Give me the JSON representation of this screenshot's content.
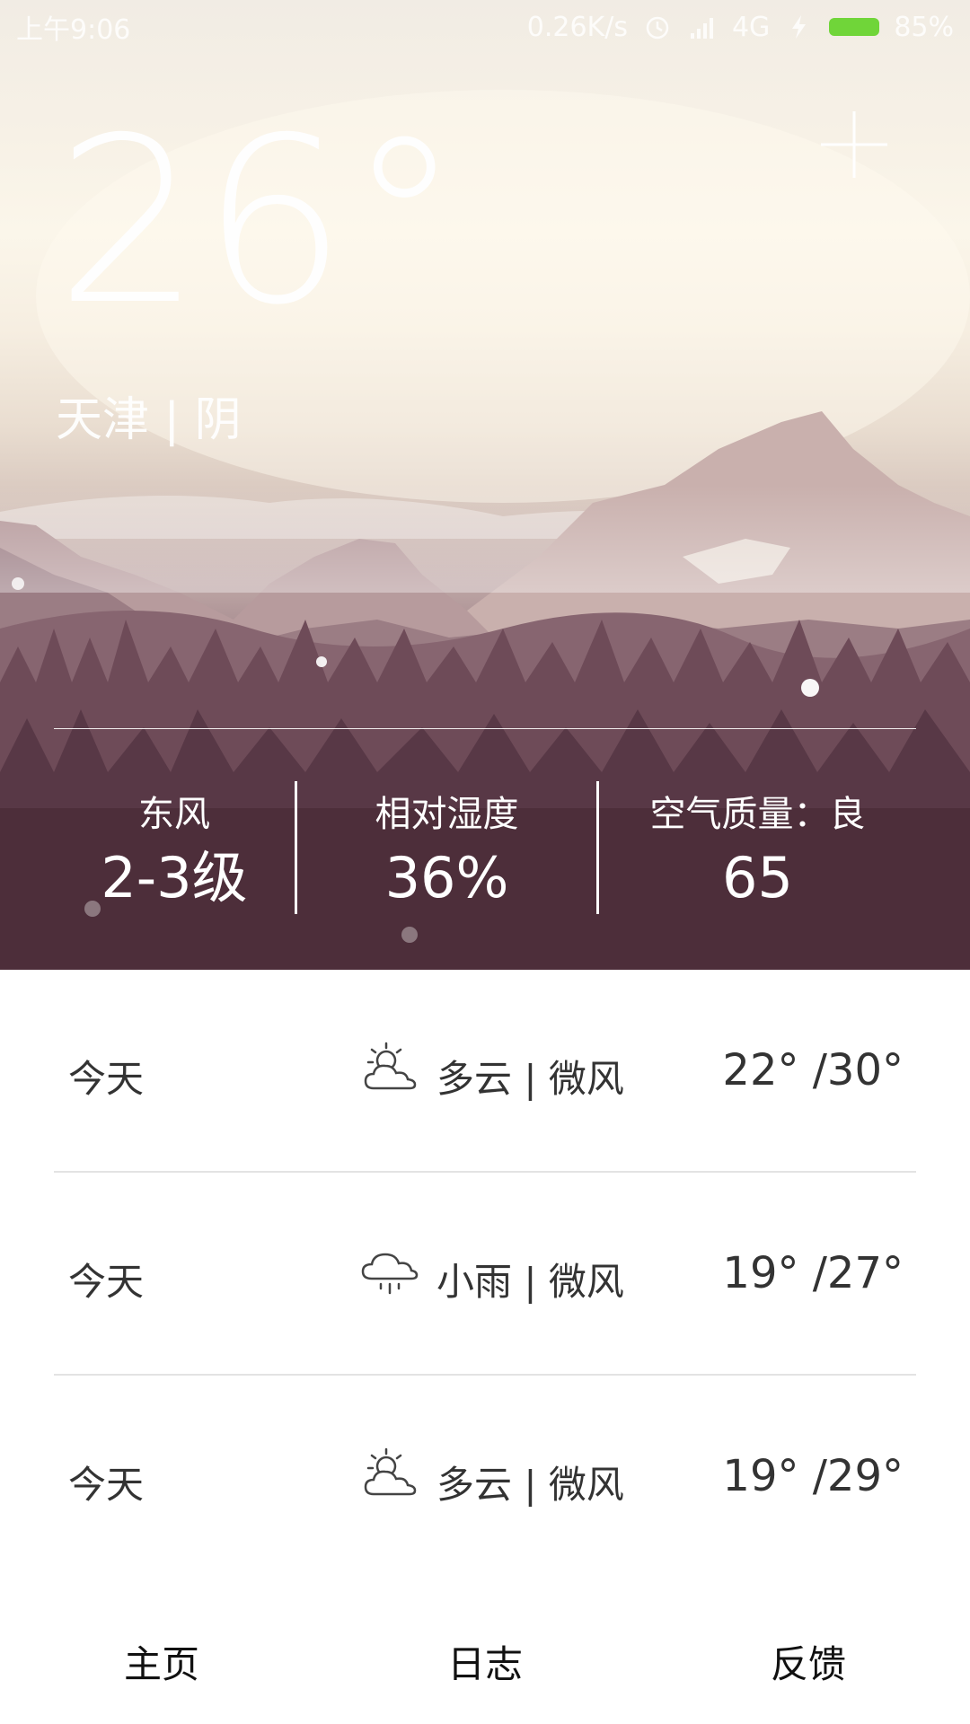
{
  "status_bar": {
    "time": "上午9:06",
    "net_speed": "0.26K/s",
    "network": "4G",
    "battery": "85%"
  },
  "weather": {
    "temperature": "26°",
    "location": "天津 | 阴"
  },
  "stats": {
    "wind": {
      "label": "东风",
      "value": "2-3级"
    },
    "humidity": {
      "label": "相对湿度",
      "value": "36%"
    },
    "air_quality": {
      "label": "空气质量：良",
      "value": "65"
    }
  },
  "forecast": [
    {
      "day": "今天",
      "icon": "partly-cloudy-icon",
      "condition": "多云 | 微风",
      "range": "22° /30°"
    },
    {
      "day": "今天",
      "icon": "light-rain-icon",
      "condition": "小雨 | 微风",
      "range": "19° /27°"
    },
    {
      "day": "今天",
      "icon": "partly-cloudy-icon",
      "condition": "多云 | 微风",
      "range": "19° /29°"
    }
  ],
  "nav": {
    "home": "主页",
    "log": "日志",
    "feedback": "反馈"
  },
  "colors": {
    "battery": "#5ad11c",
    "text_dark": "#333333"
  }
}
